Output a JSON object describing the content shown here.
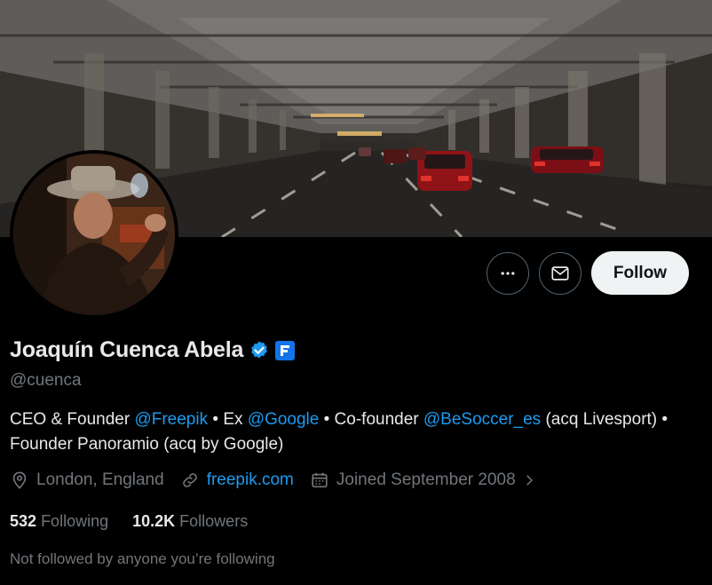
{
  "profile": {
    "display_name": "Joaquín Cuenca Abela",
    "handle": "@cuenca",
    "bio": {
      "segments": [
        {
          "text": "CEO & Founder ",
          "type": "text"
        },
        {
          "text": "@Freepik",
          "type": "mention"
        },
        {
          "text": " • Ex ",
          "type": "text"
        },
        {
          "text": "@Google",
          "type": "mention"
        },
        {
          "text": " • Co-founder ",
          "type": "text"
        },
        {
          "text": "@BeSoccer_es",
          "type": "mention"
        },
        {
          "text": " (acq Livesport) • Founder Panoramio (acq by Google)",
          "type": "text"
        }
      ]
    },
    "location": "London, England",
    "website": "freepik.com",
    "joined": "Joined September 2008",
    "following_count": "532",
    "following_label": "Following",
    "followers_count": "10.2K",
    "followers_label": "Followers",
    "not_followed_text": "Not followed by anyone you’re following"
  },
  "actions": {
    "follow_label": "Follow",
    "more_icon": "more-horizontal-icon",
    "message_icon": "envelope-icon"
  },
  "colors": {
    "accent": "#1d9bf0",
    "muted": "#71767b",
    "text": "#e7e9ea",
    "background": "#000000",
    "verified": "#1d9bf0",
    "org_badge": "#1273eb"
  },
  "icons": {
    "verified": "verified-badge-icon",
    "org": "freepik-logo-icon",
    "location": "location-pin-icon",
    "link": "link-icon",
    "calendar": "calendar-icon",
    "chevron": "chevron-right-icon"
  }
}
